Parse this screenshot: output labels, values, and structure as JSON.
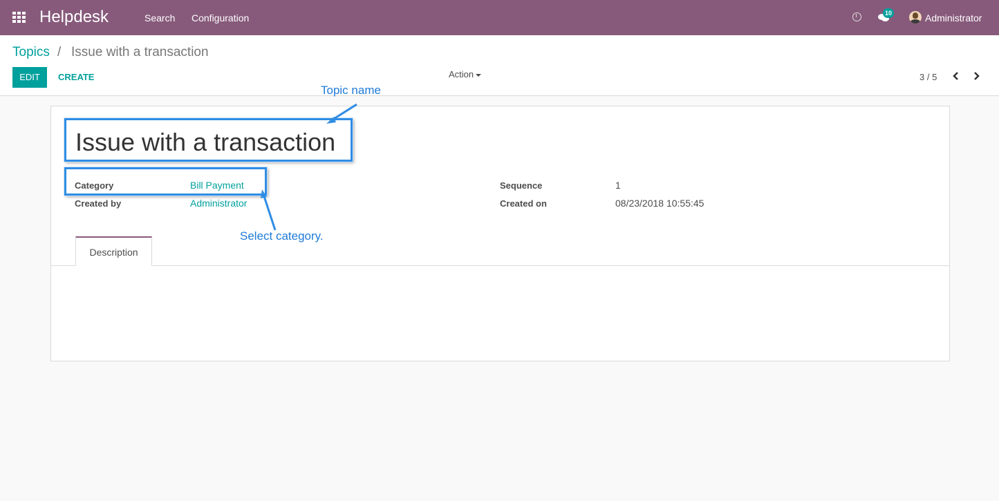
{
  "navbar": {
    "app_name": "Helpdesk",
    "menu": [
      "Search",
      "Configuration"
    ],
    "notification_count": "10",
    "user": "Administrator",
    "bg_color": "#875a7b"
  },
  "breadcrumb": {
    "parent": "Topics",
    "separator": "/",
    "current": "Issue with a transaction"
  },
  "toolbar": {
    "edit_label": "EDIT",
    "create_label": "CREATE",
    "action_label": "Action"
  },
  "pager": {
    "value": "3 / 5"
  },
  "form": {
    "title": "Issue with a transaction",
    "fields": {
      "category_label": "Category",
      "category_value": "Bill Payment",
      "created_by_label": "Created by",
      "created_by_value": "Administrator",
      "sequence_label": "Sequence",
      "sequence_value": "1",
      "created_on_label": "Created on",
      "created_on_value": "08/23/2018 10:55:45"
    },
    "tabs": [
      "Description"
    ]
  },
  "annotations": {
    "topic_name": "Topic name",
    "select_category": "Select category.",
    "color": "#2f8de4"
  },
  "colors": {
    "accent": "#00a09d",
    "text": "#4c4c4c"
  }
}
